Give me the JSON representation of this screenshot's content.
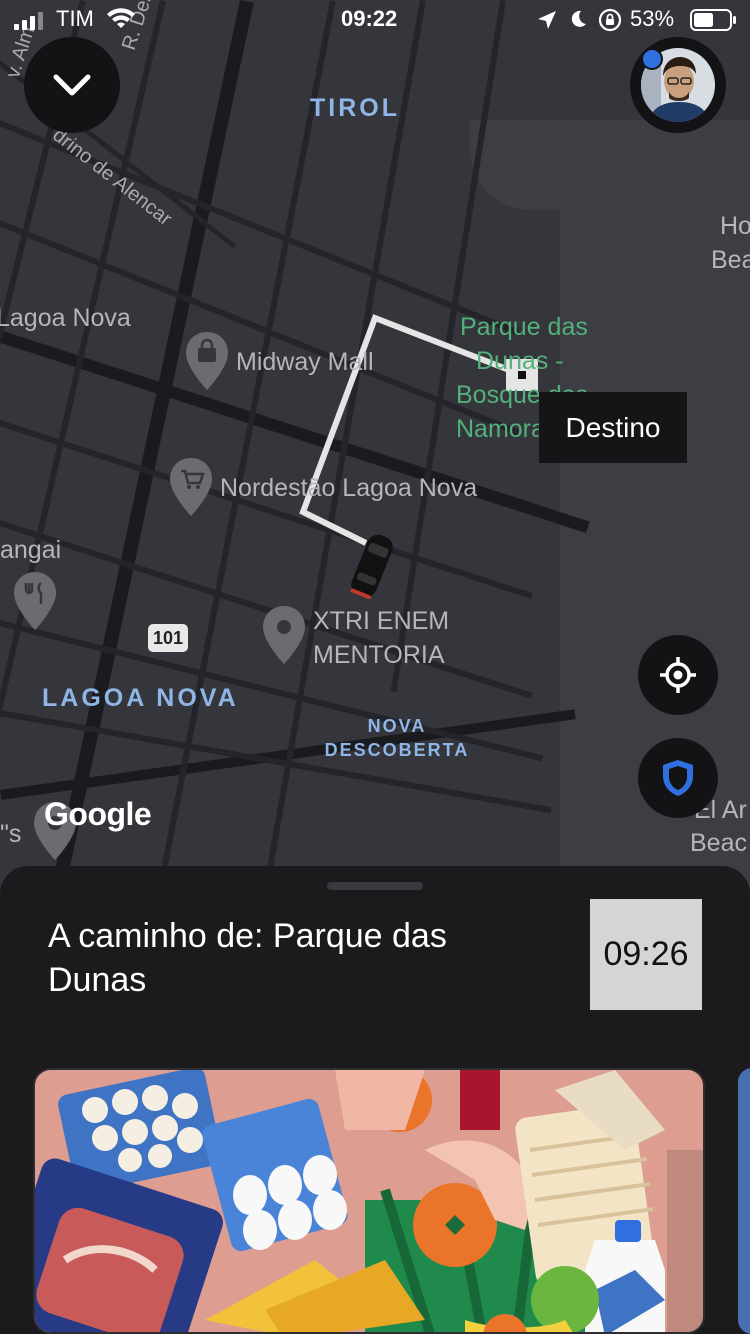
{
  "status_bar": {
    "carrier": "TIM",
    "time": "09:22",
    "battery": "53%"
  },
  "map": {
    "district_labels": {
      "tirol": "TIROL",
      "lagoa_nova": "LAGOA NOVA",
      "nova_descoberta_line1": "NOVA",
      "nova_descoberta_line2": "DESCOBERTA"
    },
    "poi_labels": {
      "midway_mall": "Midway Mall",
      "nordestao": "Nordestão Lagoa Nova",
      "xtri_line1": "XTRI ENEM",
      "xtri_line2": "MENTORIA",
      "lagoa_nova_edge": "Lagoa Nova",
      "angai": "angai",
      "s_edge": "\"s"
    },
    "park_label_lines": [
      "Parque das",
      "Dunas -",
      "Bosque dos",
      "Namora"
    ],
    "street_labels": {
      "des_regulo": "R. Des. Régu",
      "pedrino": "drino de Alencar",
      "av_alm": "v. Alm"
    },
    "edge_labels": {
      "ho": "Ho",
      "bea": "Bea",
      "el_ar": "El Ar",
      "beac": "Beac"
    },
    "route_shield": "101",
    "destination_callout": "Destino",
    "attribution": "Google"
  },
  "controls": {
    "collapse_icon": "chevron-down-icon",
    "locate_icon": "crosshair-icon",
    "safety_icon": "shield-icon",
    "accent": "#2f6fe0"
  },
  "trip": {
    "title": "A caminho de: Parque das Dunas",
    "eta": "09:26"
  }
}
